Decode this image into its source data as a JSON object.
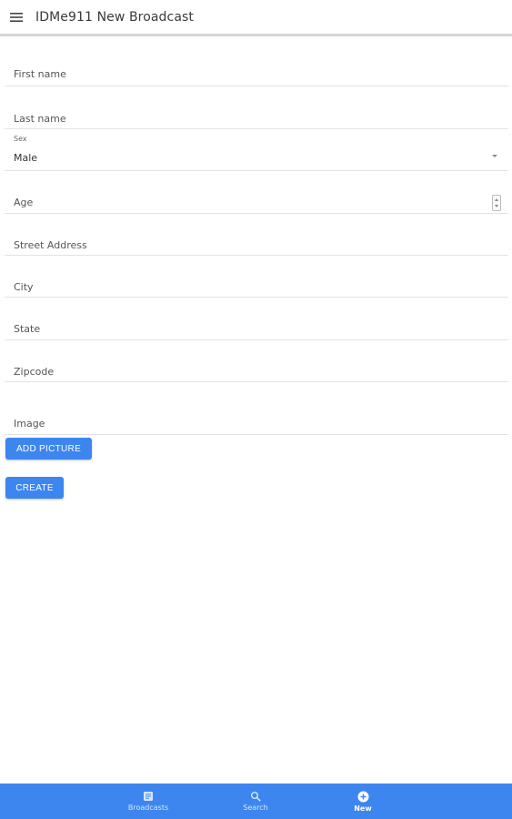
{
  "app": {
    "title": "IDMe911 New Broadcast",
    "menu_icon": "hamburger-menu-icon"
  },
  "form": {
    "first_name": {
      "label": "First name"
    },
    "last_name": {
      "label": "Last name"
    },
    "sex": {
      "label": "Sex",
      "value": "Male"
    },
    "age": {
      "label": "Age"
    },
    "street": {
      "label": "Street Address"
    },
    "city": {
      "label": "City"
    },
    "state": {
      "label": "State"
    },
    "zipcode": {
      "label": "Zipcode"
    },
    "image": {
      "label": "Image"
    }
  },
  "buttons": {
    "add_picture": "ADD PICTURE",
    "create": "CREATE"
  },
  "bottom_nav": {
    "items": [
      {
        "label": "Broadcasts",
        "icon": "list-icon",
        "active": false
      },
      {
        "label": "Search",
        "icon": "search-icon",
        "active": false
      },
      {
        "label": "New",
        "icon": "add-circle-icon",
        "active": true
      }
    ]
  },
  "colors": {
    "accent": "#3d86f0",
    "divider": "#e3e3e3"
  }
}
